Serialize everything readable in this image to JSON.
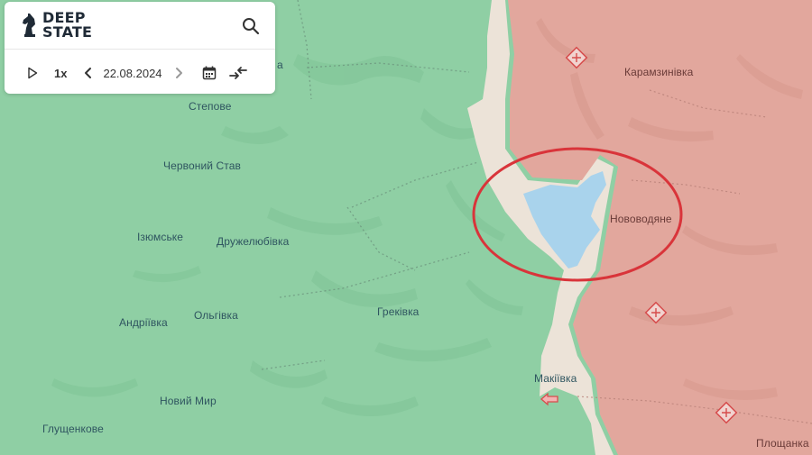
{
  "app": {
    "logo_line1": "DEEP",
    "logo_line2": "STATE"
  },
  "controls": {
    "play_icon": "play-icon",
    "speed": "1x",
    "prev_icon": "chevron-left-icon",
    "date": "22.08.2024",
    "next_icon": "chevron-right-icon",
    "calendar_icon": "calendar-icon",
    "compare_icon": "compare-arrows-icon"
  },
  "search_icon": "search-icon",
  "colors": {
    "controlled_territory": "#8fcfa4",
    "occupied_territory": "#e2a79d",
    "gray_zone": "#ece3d8",
    "flooded_area": "#a9d3ec",
    "highlight_circle": "#d9343a",
    "marker": "#d64c4c"
  },
  "places": [
    {
      "name": "Степове"
    },
    {
      "name": "Червоний Став"
    },
    {
      "name": "Ізюмське"
    },
    {
      "name": "Дружелюбівка"
    },
    {
      "name": "Андріївка"
    },
    {
      "name": "Ольгівка"
    },
    {
      "name": "Греківка"
    },
    {
      "name": "Новий Мир"
    },
    {
      "name": "Глущенкове"
    },
    {
      "name": "Карамзинівка"
    },
    {
      "name": "Нововодяне"
    },
    {
      "name": "Макіївка"
    },
    {
      "name": "Площанка"
    },
    {
      "name": "а"
    }
  ]
}
